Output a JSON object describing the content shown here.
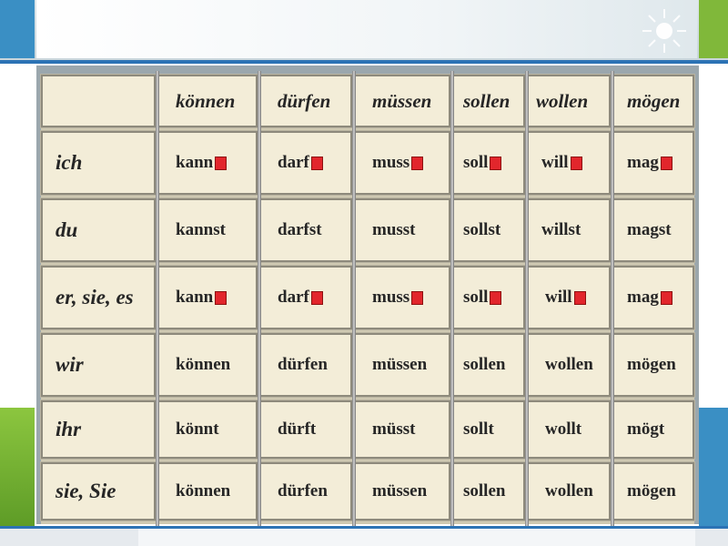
{
  "table": {
    "headers": [
      "",
      "können",
      "dürfen",
      "müssen",
      "sollen",
      "wollen",
      "mögen"
    ],
    "rows": [
      {
        "pronoun": "ich",
        "forms": [
          "kann",
          "darf",
          "muss",
          "soll",
          "will",
          "mag"
        ],
        "marked": true
      },
      {
        "pronoun": "du",
        "forms": [
          "kannst",
          "darfst",
          "musst",
          "sollst",
          "willst",
          "magst"
        ],
        "marked": false
      },
      {
        "pronoun": "er, sie, es",
        "forms": [
          "kann",
          "darf",
          "muss",
          "soll",
          "will",
          "mag"
        ],
        "marked": true
      },
      {
        "pronoun": "wir",
        "forms": [
          "können",
          "dürfen",
          "müssen",
          "sollen",
          "wollen",
          "mögen"
        ],
        "marked": false
      },
      {
        "pronoun": "ihr",
        "forms": [
          "könnt",
          "dürft",
          "müsst",
          "sollt",
          "wollt",
          "mögt"
        ],
        "marked": false
      },
      {
        "pronoun": "sie, Sie",
        "forms": [
          "können",
          "dürfen",
          "müssen",
          "sollen",
          "wollen",
          "mögen"
        ],
        "marked": false
      }
    ]
  },
  "colors": {
    "marker": "#e2262c",
    "cell_background": "#f3edd8",
    "accent_blue": "#3a8fc4",
    "accent_green": "#80b83a"
  },
  "icons": {
    "ending_marker": "red-square-icon",
    "decoration": "sun-icon"
  }
}
